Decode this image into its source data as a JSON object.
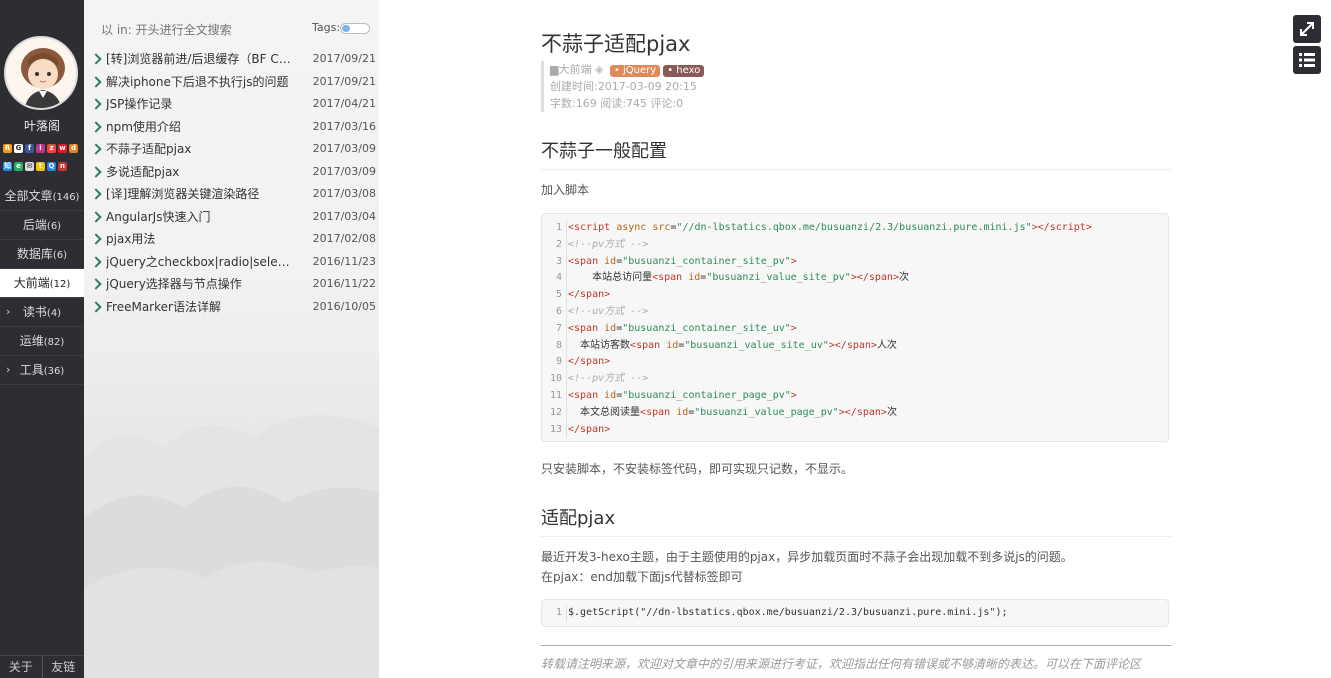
{
  "sidebar": {
    "author": "叶落阁",
    "social_icons": [
      {
        "name": "rss-icon",
        "color": "#f39c12",
        "glyph": "R"
      },
      {
        "name": "github-icon",
        "color": "#ffffff",
        "glyph": "G"
      },
      {
        "name": "facebook-icon",
        "color": "#3b5998",
        "glyph": "f"
      },
      {
        "name": "instagram-icon",
        "color": "#c13584",
        "glyph": "i"
      },
      {
        "name": "zhihu-icon",
        "color": "#e74c3c",
        "glyph": "z"
      },
      {
        "name": "weibo-icon",
        "color": "#e6162d",
        "glyph": "w"
      },
      {
        "name": "douban-icon",
        "color": "#e67e22",
        "glyph": "d"
      },
      {
        "name": "zhihu2-icon",
        "color": "#1e88e5",
        "glyph": "知"
      },
      {
        "name": "evernote-icon",
        "color": "#27ae60",
        "glyph": "e"
      },
      {
        "name": "mail-icon",
        "color": "#dddddd",
        "glyph": "✉"
      },
      {
        "name": "tieba-icon",
        "color": "#f1c40f",
        "glyph": "t"
      },
      {
        "name": "qq-icon",
        "color": "#1e88e5",
        "glyph": "Q"
      },
      {
        "name": "netease-icon",
        "color": "#c0392b",
        "glyph": "n"
      }
    ],
    "categories": [
      {
        "label": "全部文章",
        "count": "(146)",
        "arrow": false,
        "active": false
      },
      {
        "label": "后端",
        "count": "(6)",
        "arrow": false,
        "active": false
      },
      {
        "label": "数据库",
        "count": "(6)",
        "arrow": false,
        "active": false
      },
      {
        "label": "大前端",
        "count": "(12)",
        "arrow": false,
        "active": true
      },
      {
        "label": "读书",
        "count": "(4)",
        "arrow": true,
        "active": false
      },
      {
        "label": "运维",
        "count": "(82)",
        "arrow": false,
        "active": false
      },
      {
        "label": "工具",
        "count": "(36)",
        "arrow": true,
        "active": false
      }
    ],
    "footer": {
      "about": "关于",
      "links": "友链"
    }
  },
  "list": {
    "search_placeholder": "以 in: 开头进行全文搜索",
    "tags_label": "Tags:",
    "posts": [
      {
        "title": "[转]浏览器前进/后退缓存（BF Cac...",
        "date": "2017/09/21"
      },
      {
        "title": "解决iphone下后退不执行js的问题",
        "date": "2017/09/21"
      },
      {
        "title": "JSP操作记录",
        "date": "2017/04/21"
      },
      {
        "title": "npm使用介绍",
        "date": "2017/03/16"
      },
      {
        "title": "不蒜子适配pjax",
        "date": "2017/03/09"
      },
      {
        "title": "多说适配pjax",
        "date": "2017/03/09"
      },
      {
        "title": "[译]理解浏览器关键渲染路径",
        "date": "2017/03/08"
      },
      {
        "title": "AngularJs快速入门",
        "date": "2017/03/04"
      },
      {
        "title": "pjax用法",
        "date": "2017/02/08"
      },
      {
        "title": "jQuery之checkbox|radio|select操作",
        "date": "2016/11/23"
      },
      {
        "title": "jQuery选择器与节点操作",
        "date": "2016/11/22"
      },
      {
        "title": "FreeMarker语法详解",
        "date": "2016/10/05"
      }
    ]
  },
  "article": {
    "title": "不蒜子适配pjax",
    "meta": {
      "category": "大前端",
      "tags": [
        {
          "label": "jQuery",
          "color": "#e08a5a"
        },
        {
          "label": "hexo",
          "color": "#8a5a5a"
        }
      ],
      "created": "创建时间:2017-03-09 20:15",
      "stats": "字数:169 阅读:745 评论:0"
    },
    "section1_title": "不蒜子一般配置",
    "para1": "加入脚本",
    "code1": [
      "1",
      "2",
      "3",
      "4",
      "5",
      "6",
      "7",
      "8",
      "9",
      "10",
      "11",
      "12",
      "13"
    ],
    "para2": "只安装脚本，不安装标签代码，即可实现只记数，不显示。",
    "section2_title": "适配pjax",
    "para3": "最近开发3-hexo主题，由于主题使用的pjax，异步加载页面时不蒜子会出现加载不到多说js的问题。",
    "para4": "在pjax：end加载下面js代替标签即可",
    "code2_ln": "1",
    "code2": "$.getScript(\"//dn-lbstatics.qbox.me/busuanzi/2.3/busuanzi.pure.mini.js\");",
    "footer_note": "转载请注明来源，欢迎对文章中的引用来源进行考证，欢迎指出任何有错误或不够清晰的表达。可以在下面评论区"
  },
  "toolbar": {
    "fullscreen_icon": "expand-icon",
    "toc_icon": "list-icon"
  }
}
